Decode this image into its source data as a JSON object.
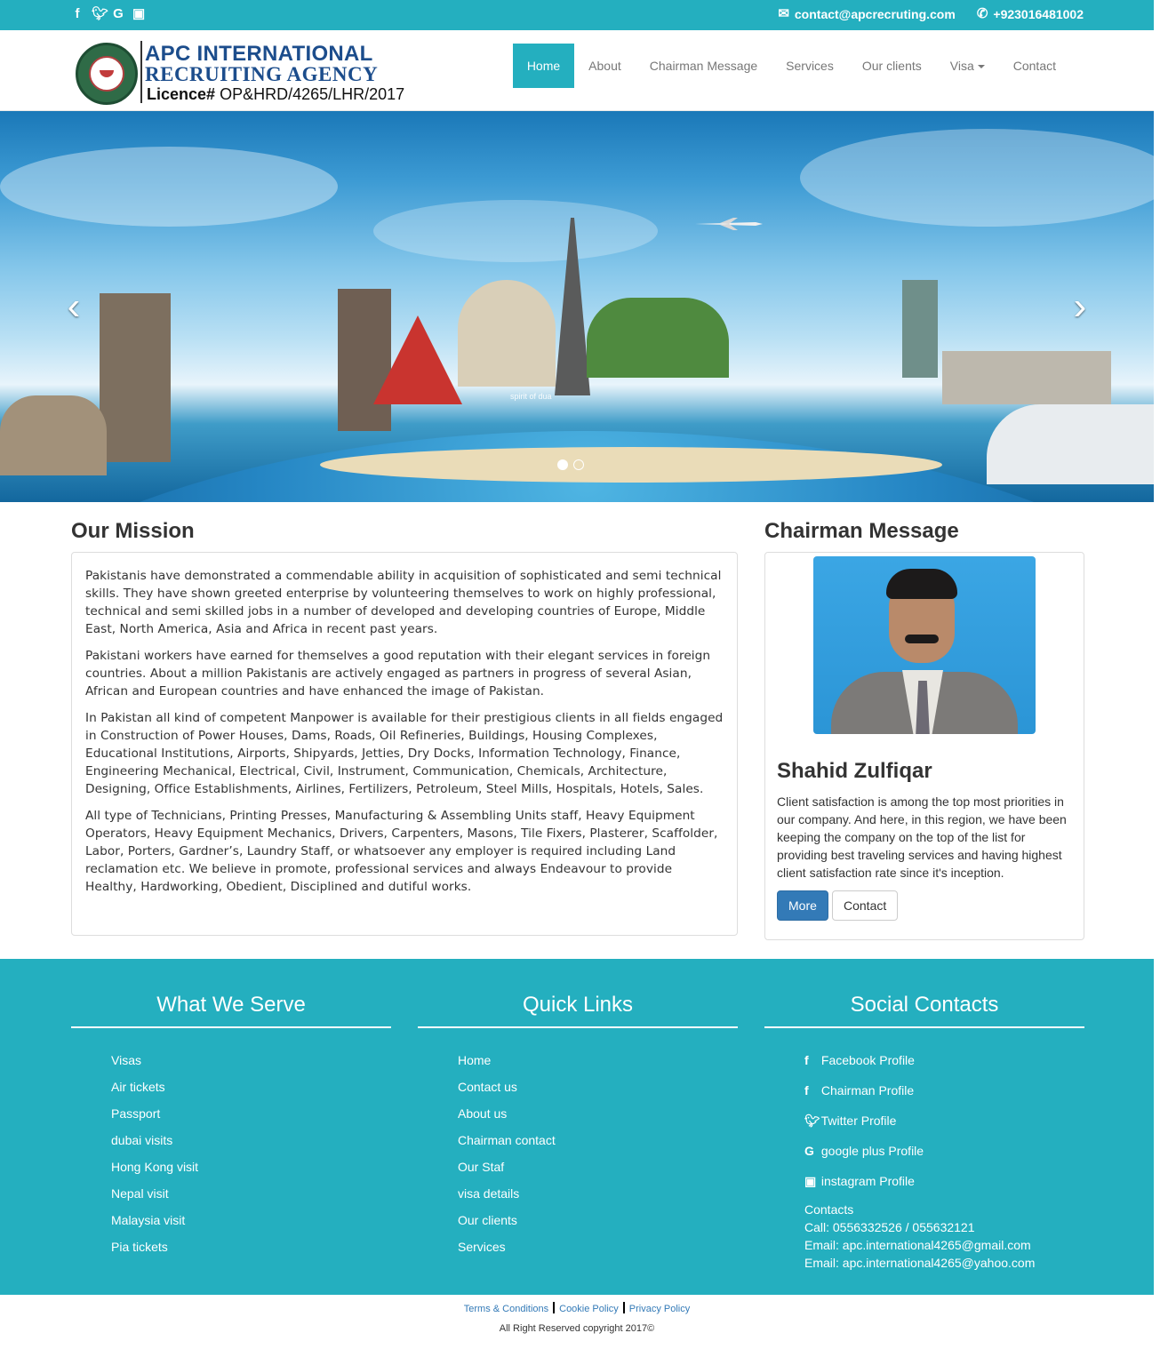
{
  "topbar": {
    "social_icons": [
      "facebook-icon",
      "twitter-icon",
      "google-plus-icon",
      "instagram-icon"
    ],
    "email": "contact@apcrecruting.com",
    "phone": "+923016481002"
  },
  "brand": {
    "line1": "APC INTERNATIONAL",
    "line2": "RECRUITING AGENCY",
    "licence_label": "Licence#",
    "licence_number": "OP&HRD/4265/LHR/2017"
  },
  "nav": {
    "items": [
      "Home",
      "About",
      "Chairman Message",
      "Services",
      "Our clients",
      "Visa",
      "Contact"
    ],
    "active": "Home"
  },
  "hero": {
    "caption": "spirit of dua",
    "slide_count": 2,
    "active_slide": 1
  },
  "mission": {
    "title": "Our Mission",
    "paragraphs": [
      "Pakistanis have demonstrated a commendable ability in acquisition of sophisticated and semi technical skills. They have shown greeted enterprise by volunteering themselves to work on highly professional, technical and semi skilled jobs in a number of developed and developing countries of Europe, Middle East, North America, Asia and Africa in recent past years.",
      "Pakistani workers have earned for themselves a good reputation with their elegant services in foreign countries. About a million Pakistanis are actively engaged as partners in progress of several Asian, African and European countries and have enhanced the image of Pakistan.",
      "In Pakistan all kind of competent Manpower is available for their prestigious clients in all fields engaged in Construction of Power Houses, Dams, Roads, Oil Refineries, Buildings, Housing Complexes, Educational Institutions, Airports, Shipyards, Jetties, Dry Docks, Information Technology, Finance, Engineering Mechanical, Electrical, Civil, Instrument, Communication, Chemicals, Architecture, Designing, Office Establishments, Airlines, Fertilizers, Petroleum, Steel Mills, Hospitals, Hotels, Sales.",
      "All type of Technicians, Printing Presses, Manufacturing & Assembling Units staff, Heavy Equipment Operators, Heavy Equipment Mechanics, Drivers, Carpenters, Masons, Tile Fixers, Plasterer, Scaffolder, Labor, Porters, Gardner’s, Laundry Staff, or whatsoever any employer is required including Land reclamation etc. We believe in promote, professional services and always Endeavour to provide Healthy, Hardworking, Obedient, Disciplined and dutiful works."
    ]
  },
  "chairman": {
    "title": "Chairman Message",
    "name": "Shahid Zulfiqar",
    "message": "Client satisfaction is among the top most priorities in our company. And here, in this region, we have been keeping the company on the top of the list for providing best traveling services and having highest client satisfaction rate since it's inception.",
    "more_label": "More",
    "contact_label": "Contact"
  },
  "footer": {
    "serve": {
      "title": "What We Serve",
      "items": [
        "Visas",
        "Air tickets",
        "Passport",
        "dubai visits",
        "Hong Kong visit",
        "Nepal visit",
        "Malaysia visit",
        "Pia tickets"
      ]
    },
    "quick": {
      "title": "Quick Links",
      "items": [
        "Home",
        "Contact us",
        "About us",
        "Chairman contact",
        "Our Staf",
        "visa details",
        "Our clients",
        "Services"
      ]
    },
    "social": {
      "title": "Social Contacts",
      "items": [
        {
          "icon": "facebook-icon",
          "label": "Facebook Profile"
        },
        {
          "icon": "facebook-icon",
          "label": "Chairman Profile"
        },
        {
          "icon": "twitter-icon",
          "label": "Twitter Profile"
        },
        {
          "icon": "google-plus-icon",
          "label": "google plus Profile"
        },
        {
          "icon": "instagram-icon",
          "label": "instagram Profile"
        }
      ],
      "contacts_label": "Contacts",
      "call": "Call: 0556332526 / 055632121",
      "email1": "Email: apc.international4265@gmail.com",
      "email2": "Email: apc.international4265@yahoo.com"
    }
  },
  "bottom": {
    "terms": "Terms & Conditions",
    "cookie": "Cookie Policy",
    "privacy": "Privacy Policy",
    "copyright": "All Right Reserved copyright 2017©"
  },
  "colors": {
    "brand_teal": "#24afbf",
    "primary_button": "#337ab7",
    "logo_blue": "#1c4d8c"
  }
}
